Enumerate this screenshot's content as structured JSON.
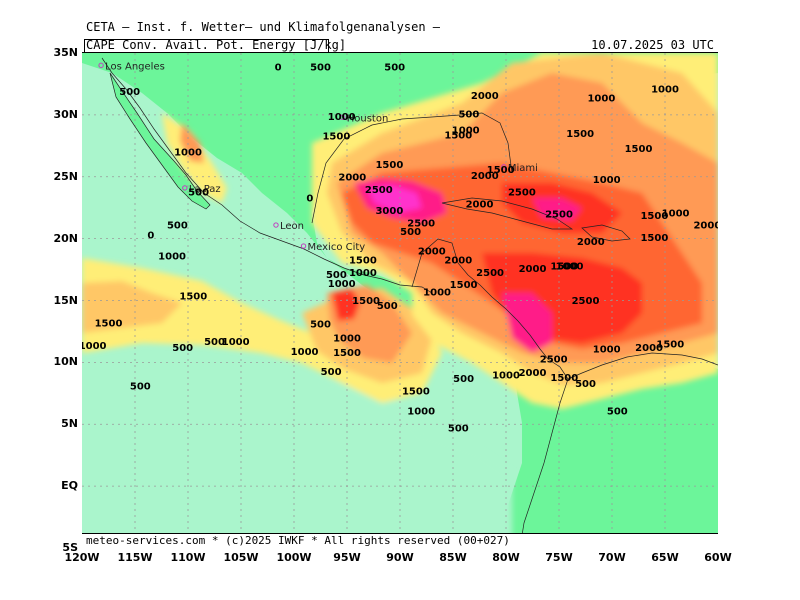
{
  "header": {
    "title": "CETA – Inst. f. Wetter– und Klimafolgenanalysen –",
    "parameter": "CAPE Conv. Avail. Pot. Energy [J/kg]",
    "valid_time": "10.07.2025 03 UTC"
  },
  "footer": {
    "credit": "meteo-services.com * (c)2025 IWKF * All rights reserved (00+027)"
  },
  "axes": {
    "lat_labels": [
      "35N",
      "30N",
      "25N",
      "20N",
      "15N",
      "10N",
      "5N",
      "EQ",
      "5S"
    ],
    "lon_labels": [
      "120W",
      "115W",
      "110W",
      "105W",
      "100W",
      "95W",
      "90W",
      "85W",
      "80W",
      "75W",
      "70W",
      "65W",
      "60W"
    ]
  },
  "colors": {
    "ocean_low": "#aaf5cc",
    "land_low": "#6cf59a",
    "yellow": "#ffee77",
    "light_orange": "#ffc766",
    "orange": "#ff9a55",
    "red_orange": "#ff6633",
    "red": "#ff3320",
    "magenta": "#ff1f88",
    "pink": "#ff33cc"
  },
  "cities": [
    {
      "name": "Los Angeles",
      "lon": -118.2,
      "lat": 34.0
    },
    {
      "name": "Houston",
      "lon": -95.4,
      "lat": 29.8
    },
    {
      "name": "Miami",
      "lon": -80.2,
      "lat": 25.8
    },
    {
      "name": "La Paz",
      "lon": -110.3,
      "lat": 24.1
    },
    {
      "name": "Leon",
      "lon": -101.7,
      "lat": 21.1
    },
    {
      "name": "Mexico City",
      "lon": -99.1,
      "lat": 19.4
    }
  ],
  "contour_labels": [
    {
      "text": "0",
      "lon": -101.5,
      "lat": 33.6
    },
    {
      "text": "500",
      "lon": -97.5,
      "lat": 33.6
    },
    {
      "text": "500",
      "lon": -90.5,
      "lat": 33.6
    },
    {
      "text": "500",
      "lon": -115.5,
      "lat": 31.6
    },
    {
      "text": "1000",
      "lon": -95.5,
      "lat": 29.6
    },
    {
      "text": "1500",
      "lon": -96.0,
      "lat": 28.0
    },
    {
      "text": "500",
      "lon": -83.5,
      "lat": 29.8
    },
    {
      "text": "1000",
      "lon": -83.8,
      "lat": 28.5
    },
    {
      "text": "1500",
      "lon": -84.5,
      "lat": 28.1
    },
    {
      "text": "2000",
      "lon": -82.0,
      "lat": 31.3
    },
    {
      "text": "1000",
      "lon": -71.0,
      "lat": 31.1
    },
    {
      "text": "1000",
      "lon": -65.0,
      "lat": 31.8
    },
    {
      "text": "1500",
      "lon": -73.0,
      "lat": 28.2
    },
    {
      "text": "1500",
      "lon": -67.5,
      "lat": 27.0
    },
    {
      "text": "1000",
      "lon": -110.0,
      "lat": 26.7
    },
    {
      "text": "1500",
      "lon": -91.0,
      "lat": 25.7
    },
    {
      "text": "2000",
      "lon": -94.5,
      "lat": 24.7
    },
    {
      "text": "2500",
      "lon": -92.0,
      "lat": 23.7
    },
    {
      "text": "0",
      "lon": -98.5,
      "lat": 23.0
    },
    {
      "text": "2000",
      "lon": -82.0,
      "lat": 24.8
    },
    {
      "text": "1500",
      "lon": -80.5,
      "lat": 25.3
    },
    {
      "text": "2500",
      "lon": -78.5,
      "lat": 23.5
    },
    {
      "text": "1000",
      "lon": -70.5,
      "lat": 24.5
    },
    {
      "text": "3000",
      "lon": -91.0,
      "lat": 22.0
    },
    {
      "text": "2500",
      "lon": -88.0,
      "lat": 21.0
    },
    {
      "text": "2000",
      "lon": -82.5,
      "lat": 22.5
    },
    {
      "text": "2500",
      "lon": -75.0,
      "lat": 21.7
    },
    {
      "text": "1500",
      "lon": -66.0,
      "lat": 21.6
    },
    {
      "text": "1000",
      "lon": -64.0,
      "lat": 21.8
    },
    {
      "text": "2000",
      "lon": -61.0,
      "lat": 20.8
    },
    {
      "text": "500",
      "lon": -109.0,
      "lat": 23.5
    },
    {
      "text": "500",
      "lon": -111.0,
      "lat": 20.8
    },
    {
      "text": "0",
      "lon": -113.5,
      "lat": 20.0
    },
    {
      "text": "500",
      "lon": -89.0,
      "lat": 20.3
    },
    {
      "text": "2000",
      "lon": -72.0,
      "lat": 19.5
    },
    {
      "text": "1500",
      "lon": -66.0,
      "lat": 19.8
    },
    {
      "text": "1000",
      "lon": -111.5,
      "lat": 18.3
    },
    {
      "text": "1500",
      "lon": -93.5,
      "lat": 18.0
    },
    {
      "text": "1000",
      "lon": -93.5,
      "lat": 17.0
    },
    {
      "text": "2000",
      "lon": -87.0,
      "lat": 18.7
    },
    {
      "text": "2000",
      "lon": -84.5,
      "lat": 18.0
    },
    {
      "text": "2500",
      "lon": -81.5,
      "lat": 17.0
    },
    {
      "text": "2000",
      "lon": -77.5,
      "lat": 17.3
    },
    {
      "text": "1500",
      "lon": -74.5,
      "lat": 17.5
    },
    {
      "text": "1000",
      "lon": -74.0,
      "lat": 17.5
    },
    {
      "text": "500",
      "lon": -96.0,
      "lat": 16.8
    },
    {
      "text": "1000",
      "lon": -95.5,
      "lat": 16.1
    },
    {
      "text": "1500",
      "lon": -84.0,
      "lat": 16.0
    },
    {
      "text": "1000",
      "lon": -86.5,
      "lat": 15.4
    },
    {
      "text": "1500",
      "lon": -109.5,
      "lat": 15.1
    },
    {
      "text": "1500",
      "lon": -93.2,
      "lat": 14.7
    },
    {
      "text": "500",
      "lon": -91.2,
      "lat": 14.3
    },
    {
      "text": "2500",
      "lon": -72.5,
      "lat": 14.7
    },
    {
      "text": "1500",
      "lon": -117.5,
      "lat": 12.9
    },
    {
      "text": "500",
      "lon": -97.5,
      "lat": 12.8
    },
    {
      "text": "1000",
      "lon": -95.0,
      "lat": 11.7
    },
    {
      "text": "1500",
      "lon": -95.0,
      "lat": 10.5
    },
    {
      "text": "1000",
      "lon": -119.0,
      "lat": 11.1
    },
    {
      "text": "500",
      "lon": -110.5,
      "lat": 10.9
    },
    {
      "text": "500",
      "lon": -107.5,
      "lat": 11.4
    },
    {
      "text": "1000",
      "lon": -105.5,
      "lat": 11.4
    },
    {
      "text": "1000",
      "lon": -99.0,
      "lat": 10.6
    },
    {
      "text": "2500",
      "lon": -75.5,
      "lat": 10.0
    },
    {
      "text": "1000",
      "lon": -70.5,
      "lat": 10.8
    },
    {
      "text": "2000",
      "lon": -66.5,
      "lat": 10.9
    },
    {
      "text": "1500",
      "lon": -64.5,
      "lat": 11.2
    },
    {
      "text": "500",
      "lon": -96.5,
      "lat": 9.0
    },
    {
      "text": "2000",
      "lon": -77.5,
      "lat": 8.9
    },
    {
      "text": "1000",
      "lon": -80.0,
      "lat": 8.7
    },
    {
      "text": "1500",
      "lon": -74.5,
      "lat": 8.5
    },
    {
      "text": "500",
      "lon": -84.0,
      "lat": 8.4
    },
    {
      "text": "500",
      "lon": -72.5,
      "lat": 8.0
    },
    {
      "text": "500",
      "lon": -114.5,
      "lat": 7.8
    },
    {
      "text": "1500",
      "lon": -88.5,
      "lat": 7.4
    },
    {
      "text": "1000",
      "lon": -88.0,
      "lat": 5.8
    },
    {
      "text": "500",
      "lon": -69.5,
      "lat": 5.8
    },
    {
      "text": "500",
      "lon": -84.5,
      "lat": 4.4
    }
  ]
}
